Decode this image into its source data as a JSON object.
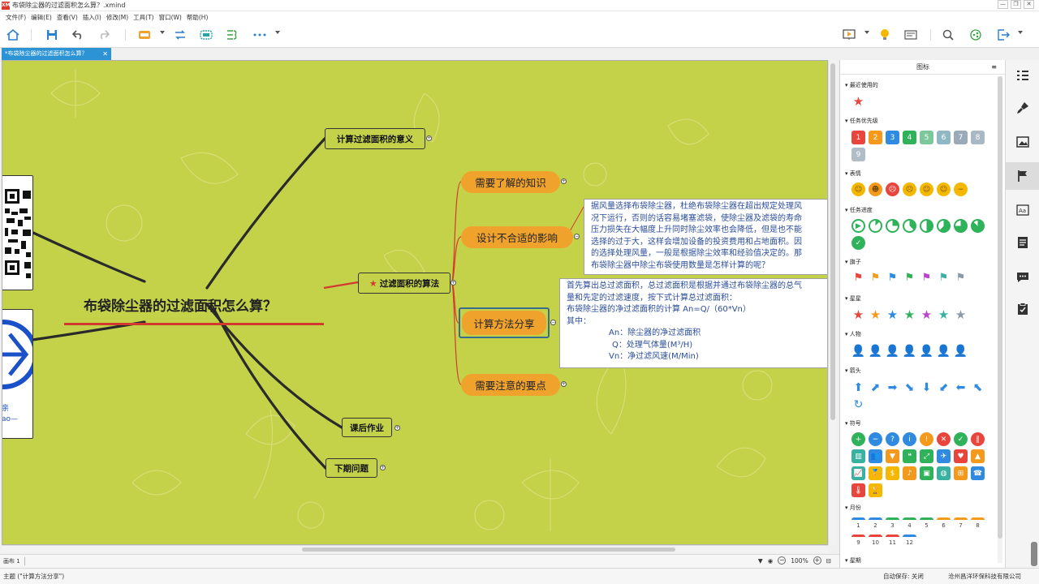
{
  "window": {
    "title": "布袋除尘器的过滤面积怎么算？.xmind",
    "app_icon": "XM"
  },
  "menu": [
    "文件(F)",
    "编辑(E)",
    "查看(V)",
    "插入(I)",
    "修改(M)",
    "工具(T)",
    "窗口(W)",
    "帮助(H)"
  ],
  "tab": {
    "label": "*布袋除尘器的过滤面积怎么算？",
    "close": "✕"
  },
  "map": {
    "central": "布袋除尘器的过滤面积怎么算？",
    "branches": {
      "meaning": "计算过滤面积的意义",
      "algorithm": "过滤面积的算法",
      "homework": "课后作业",
      "next": "下期问题"
    },
    "subtopics": {
      "knowledge": "需要了解的知识",
      "impact": "设计不合适的影响",
      "method": "计算方法分享",
      "caution": "需要注意的要点"
    },
    "note1": [
      "据风量选择布袋除尘器，杜绝布袋除尘器在超出规定处理风",
      "况下运行，否则的话容易堵塞滤袋，使除尘器及滤袋的寿命",
      "压力损失在大幅度上升同时除尘效率也会降低，但是也不能",
      "选择的过于大，这样会增加设备的投资费用和占地面积。因",
      "的选择处理风量，一般是根据除尘效率和经验值决定的。那",
      "布袋除尘器中除尘布袋使用数量是怎样计算的呢？"
    ],
    "note2": [
      "首先算出总过滤面积，总过滤面积是根据并通过布袋除尘器的总气",
      "量和先定的过滤速度，按下式计算总过滤面积：",
      "布袋除尘器的净过滤面积的计算 An=Q/（60*Vn）",
      "其中：",
      "An：除尘器的净过滤面积",
      "Q：处理气体量(M³/H)",
      "Vn：净过滤风速(M/Min)"
    ],
    "logo_text_1": "亲",
    "logo_text_2": "ao—"
  },
  "panel": {
    "title": "图标",
    "sections": {
      "recent": "最近使用的",
      "priority": "任务优先级",
      "smiley": "表情",
      "progress": "任务进度",
      "flags": "旗子",
      "stars": "星星",
      "people": "人物",
      "arrows": "箭头",
      "symbols": "符号",
      "months": "月份",
      "weekdays": "星期"
    },
    "priority_numbers": [
      "1",
      "2",
      "3",
      "4",
      "5",
      "6",
      "7",
      "8",
      "9"
    ],
    "month_numbers": [
      "1",
      "2",
      "3",
      "4",
      "5",
      "6",
      "7",
      "8",
      "9",
      "10",
      "11",
      "12"
    ],
    "colors": {
      "red": "#e8453c",
      "orange": "#f39a1d",
      "blue": "#2f8ae0",
      "green": "#2fb25a",
      "teal": "#38b1a0",
      "purple": "#b845c9",
      "gray": "#8a9aa8",
      "yellow": "#f5b800"
    }
  },
  "sheetbar": {
    "sheet": "画布 1",
    "zoom": "100%"
  },
  "status": {
    "left": "主题 (\"计算方法分享\")",
    "autosave": "自动保存: 关闭",
    "company": "沧州昌洋环保科技有限公司"
  }
}
